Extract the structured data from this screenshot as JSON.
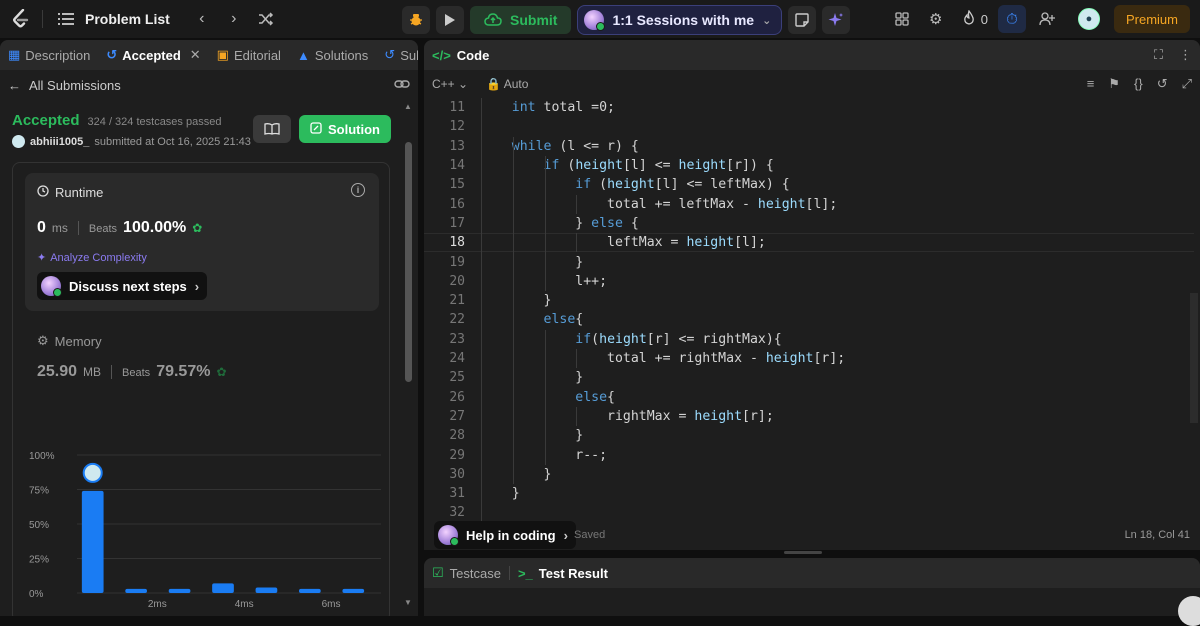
{
  "topbar": {
    "problem_list": "Problem List",
    "submit": "Submit",
    "sessions": "1:1 Sessions with me",
    "streak_count": "0",
    "premium": "Premium"
  },
  "left": {
    "tabs": [
      {
        "label": "Description"
      },
      {
        "label": "Accepted"
      },
      {
        "label": "Editorial"
      },
      {
        "label": "Solutions"
      },
      {
        "label": "Sub"
      }
    ],
    "back_label": "All Submissions",
    "status": "Accepted",
    "testcases": "324 / 324 testcases passed",
    "username": "abhiii1005_",
    "submitted_at": "submitted at Oct 16, 2025 21:43",
    "solution_btn": "Solution",
    "runtime": {
      "title": "Runtime",
      "value": "0",
      "unit": "ms",
      "beats_label": "Beats",
      "beats_pct": "100.00%",
      "analyze": "Analyze Complexity",
      "discuss": "Discuss next steps"
    },
    "memory": {
      "title": "Memory",
      "value": "25.90",
      "unit": "MB",
      "beats_label": "Beats",
      "beats_pct": "79.57%"
    }
  },
  "chart_data": {
    "type": "bar",
    "y_ticks": [
      "100%",
      "75%",
      "50%",
      "25%",
      "0%"
    ],
    "x_ticks": [
      "2ms",
      "4ms",
      "6ms"
    ],
    "ylim": [
      0,
      100
    ],
    "values": [
      74,
      3,
      3,
      7,
      4,
      3,
      3
    ],
    "highlight_index": 0,
    "bar_color": "#1a7cf3",
    "grid": true
  },
  "editor": {
    "tab_label": "Code",
    "language": "C++",
    "mode": "Auto",
    "lines": [
      {
        "n": "11",
        "text": "    int total =0;"
      },
      {
        "n": "12",
        "text": ""
      },
      {
        "n": "13",
        "text": "    while (l <= r) {"
      },
      {
        "n": "14",
        "text": "        if (height[l] <= height[r]) {"
      },
      {
        "n": "15",
        "text": "            if (height[l] <= leftMax) {"
      },
      {
        "n": "16",
        "text": "                total += leftMax - height[l];"
      },
      {
        "n": "17",
        "text": "            } else {"
      },
      {
        "n": "18",
        "text": "                leftMax = height[l];"
      },
      {
        "n": "19",
        "text": "            }"
      },
      {
        "n": "20",
        "text": "            l++;"
      },
      {
        "n": "21",
        "text": "        }"
      },
      {
        "n": "22",
        "text": "        else{"
      },
      {
        "n": "23",
        "text": "            if(height[r] <= rightMax){"
      },
      {
        "n": "24",
        "text": "                total += rightMax - height[r];"
      },
      {
        "n": "25",
        "text": "            }"
      },
      {
        "n": "26",
        "text": "            else{"
      },
      {
        "n": "27",
        "text": "                rightMax = height[r];"
      },
      {
        "n": "28",
        "text": "            }"
      },
      {
        "n": "29",
        "text": "            r--;"
      },
      {
        "n": "30",
        "text": "        }"
      },
      {
        "n": "31",
        "text": "    }"
      },
      {
        "n": "32",
        "text": ""
      }
    ],
    "current_line": "18",
    "help": "Help in coding",
    "saved": "Saved",
    "cursor": "Ln 18, Col 41"
  },
  "bottom": {
    "testcase": "Testcase",
    "test_result": "Test Result"
  }
}
